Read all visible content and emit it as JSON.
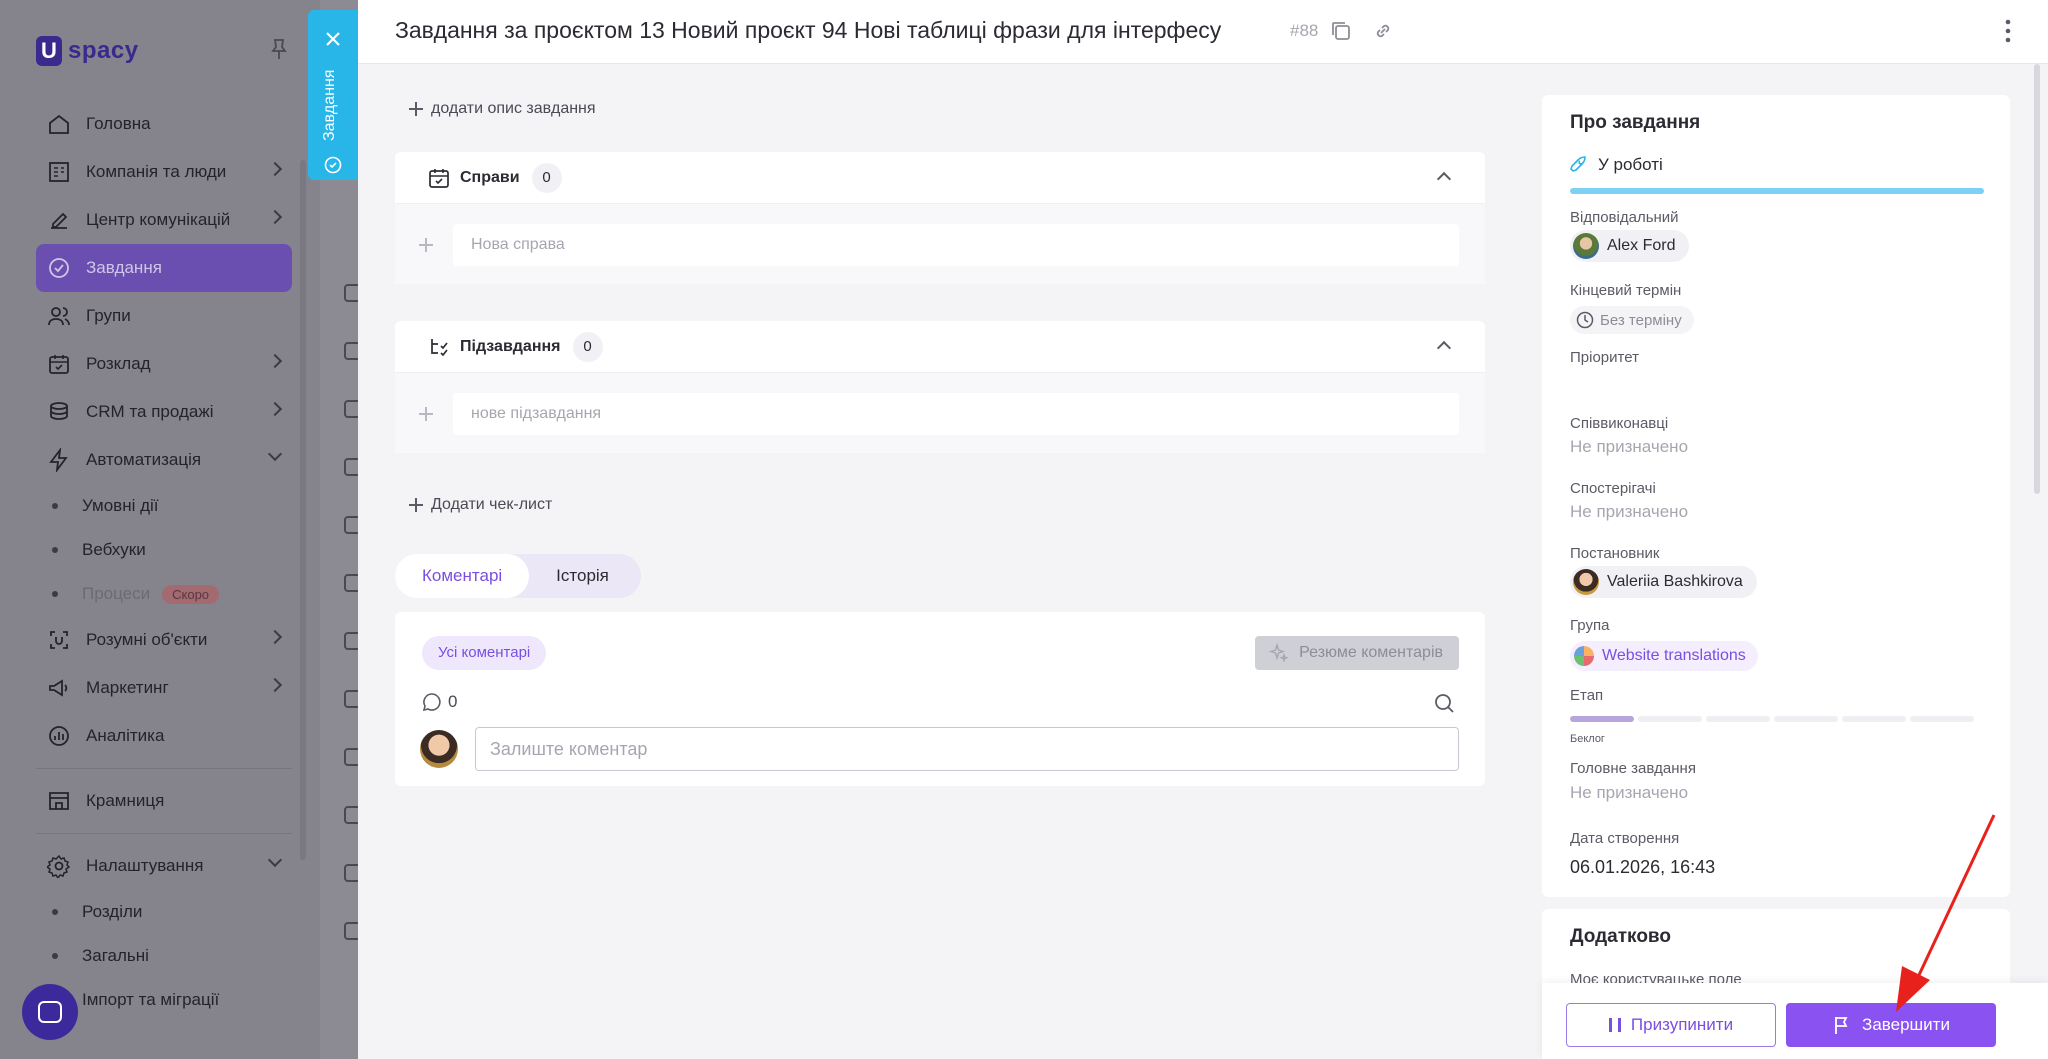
{
  "sidebar": {
    "logo": "spacy",
    "items": [
      {
        "label": "Головна"
      },
      {
        "label": "Компанія та люди"
      },
      {
        "label": "Центр комунікацій"
      },
      {
        "label": "Завдання"
      },
      {
        "label": "Групи"
      },
      {
        "label": "Розклад"
      },
      {
        "label": "CRM та продажі"
      },
      {
        "label": "Автоматизація"
      }
    ],
    "automation_sub": [
      "Умовні дії",
      "Вебхуки",
      "Процеси"
    ],
    "soon_badge": "Скоро",
    "items2": [
      {
        "label": "Розумні об'єкти"
      },
      {
        "label": "Маркетинг"
      },
      {
        "label": "Аналітика"
      }
    ],
    "shop": "Крамниця",
    "settings": "Налаштування",
    "settings_sub": [
      "Розділи",
      "Загальні",
      "Імпорт та міграції"
    ]
  },
  "side_tab": {
    "label": "Завдання"
  },
  "header": {
    "title": "Завдання за проєктом 13 Новий проєкт 94 Нові таблиці фрази для інтерфесу",
    "task_number": "#88"
  },
  "main": {
    "add_description": "додати опис завдання",
    "cases": {
      "title": "Справи",
      "count": "0",
      "placeholder": "Нова справа"
    },
    "subtasks": {
      "title": "Підзавдання",
      "count": "0",
      "placeholder": "нове підзавдання"
    },
    "add_checklist": "Додати чек-лист",
    "tabs": [
      "Коментарі",
      "Історія"
    ],
    "comments": {
      "filter_all": "Усі коментарі",
      "summary_button": "Резюме коментарів",
      "count": "0",
      "input_placeholder": "Залиште коментар"
    }
  },
  "about": {
    "title": "Про завдання",
    "status": "У роботі",
    "responsible_label": "Відповідальний",
    "responsible": "Alex Ford",
    "deadline_label": "Кінцевий термін",
    "deadline": "Без терміну",
    "priority_label": "Пріоритет",
    "coexecutors_label": "Співвиконавці",
    "coexecutors": "Не призначено",
    "observers_label": "Спостерігачі",
    "observers": "Не призначено",
    "creator_label": "Постановник",
    "creator": "Valeriia Bashkirova",
    "group_label": "Група",
    "group": "Website translations",
    "stage_label": "Етап",
    "stage": "Беклог",
    "parent_label": "Головне завдання",
    "parent": "Не призначено",
    "created_label": "Дата створення",
    "created": "06.01.2026, 16:43"
  },
  "extra": {
    "title": "Додатково",
    "field": "Моє користувацьке поле"
  },
  "actions": {
    "pause": "Призупинити",
    "finish": "Завершити"
  },
  "colors": {
    "accent": "#8a52f0",
    "status_bar": "#7fd0f5",
    "side_tab": "#28b5e8",
    "annotation_arrow": "#e8211c"
  }
}
